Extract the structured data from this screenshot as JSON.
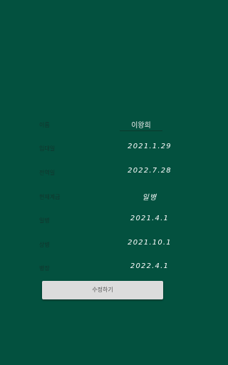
{
  "colors": {
    "background": "#03513f",
    "label_text": "#1d1d1d",
    "value_text": "#ffffff",
    "button_bg": "#dcdcdc",
    "button_text": "#555555"
  },
  "form": {
    "name": {
      "label": "이름",
      "value": "이왕희"
    },
    "rows": [
      {
        "label": "입대일",
        "value": "2021.1.29"
      },
      {
        "label": "전역일",
        "value": "2022.7.28"
      },
      {
        "label": "현재계급",
        "value": "일병"
      },
      {
        "label": "일병",
        "value": "2021.4.1"
      },
      {
        "label": "상병",
        "value": "2021.10.1"
      },
      {
        "label": "병장",
        "value": "2022.4.1"
      }
    ]
  },
  "actions": {
    "edit_label": "수정하기"
  }
}
